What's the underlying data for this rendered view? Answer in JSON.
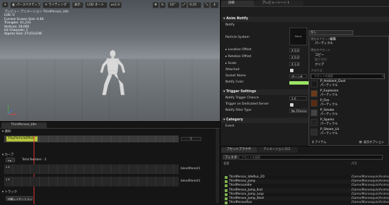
{
  "viewport": {
    "toolbar": {
      "perspective": "パースペクティブ",
      "lighting": "ライティング",
      "show": "表示",
      "lod": "LOD オート",
      "speed": "x1.0",
      "fov": "10°",
      "scale": "0.25",
      "layouts": "4"
    },
    "overlay_line1": "プレビュー アニメーション ThirdPerson_Idle",
    "info_lines": [
      "LOD: 0",
      "Current Screen Size: 0.60",
      "Triangles: 41,233",
      "Vertices: 29,092",
      "UV Channels: 1",
      "Approx Size: 27x51x106"
    ],
    "mannequin_icon": "mannequin-figure"
  },
  "details_panel": {
    "tab_details": "詳細",
    "tab_preview": "プレビューシーン 1",
    "sections": {
      "anim_notify": "Anim Notify",
      "trigger_settings": "Trigger Settings",
      "category": "Category"
    },
    "props": {
      "notify": "Notify",
      "particle_system": "Particle System",
      "particle_thumb": "None",
      "location_offset": "Location Offset",
      "location_value": "X 0.0",
      "rotation_offset": "Rotation Offset",
      "rotation_value": "X 0.0",
      "scale": "Scale",
      "scale_value": "X 1.0",
      "attached": "Attached",
      "socket_name": "Socket Name",
      "socket_value": "ボーン名",
      "notify_color": "Notify Color",
      "trigger_chance": "Notify Trigger Chance",
      "trigger_chance_value": "1.0",
      "trigger_dedicated": "Trigger on Dedicated Server",
      "filter_type": "Notify Filter Type",
      "filter_value": "No Filtering",
      "event": "Event"
    },
    "accent_green": "#9be564"
  },
  "asset_picker": {
    "selected": "なし",
    "current_asset_header": "現在のアセット",
    "edit": "編集",
    "particle_system": "パーティクル",
    "current_asset_header2": "現在のアセット",
    "copy": "コピー",
    "paste": "貼り付け",
    "clear": "クリア",
    "browse_header": "ブラウズ",
    "search_placeholder": "アセットを検索",
    "assets": [
      {
        "name": "P_Ambient_Dust",
        "type": "パーティクル",
        "color": "#1a1a1a"
      },
      {
        "name": "P_Explosion",
        "type": "パーティクル",
        "color": "#6b3a1a"
      },
      {
        "name": "P_Fire",
        "type": "パーティクル",
        "color": "#5a2a10"
      },
      {
        "name": "P_Smoke",
        "type": "パーティクル",
        "color": "#444444"
      },
      {
        "name": "P_Sparks",
        "type": "パーティクル",
        "color": "#222222"
      },
      {
        "name": "P_Steam_Lit",
        "type": "パーティクル",
        "color": "#2c2c2c"
      }
    ],
    "count": "8 アイテム",
    "view_options": "表示オプション"
  },
  "timeline": {
    "tab": "ThirdPerson_Idle",
    "notifies_header": "通知",
    "notify_name": "PlayParticleEffect",
    "notify_track_value": "1",
    "curves_header": "カーブ",
    "total_number": "Total Number : 2",
    "curve1": "blendParent1",
    "curve2": "blendParent1",
    "tracks_header": "トラック",
    "add_track": "加算レイヤートラック",
    "zoom_value": "1.0",
    "zoom_value2": "1.0"
  },
  "content_browser": {
    "tab_assets": "アセットブラウザ",
    "tab_anim_slot": "アニメーションスロ",
    "filter": "フィルタ",
    "search_placeholder": "アセットを検索",
    "col_name": "名前",
    "col_path": "パス",
    "files": [
      {
        "name": "ThirdPerson_IdleRun_2D",
        "path": "/Game/Mannequin/Animatio"
      },
      {
        "name": "ThirdPerson_Jump",
        "path": "/Game/Mannequin/Animatio"
      },
      {
        "name": "ThirdPersonIdle",
        "path": "/Game/Mannequin/Animatio"
      },
      {
        "name": "ThirdPerson_Jump_End",
        "path": "/Game/Mannequin/Animatio"
      },
      {
        "name": "ThirdPerson_Jump_Loop",
        "path": "/Game/Mannequin/Animatio"
      },
      {
        "name": "ThirdPerson_Jump_Start",
        "path": "/Game/Mannequin/Animatio"
      },
      {
        "name": "ThirdPersonRun",
        "path": "/Game/Mannequin/Animatio"
      }
    ]
  }
}
